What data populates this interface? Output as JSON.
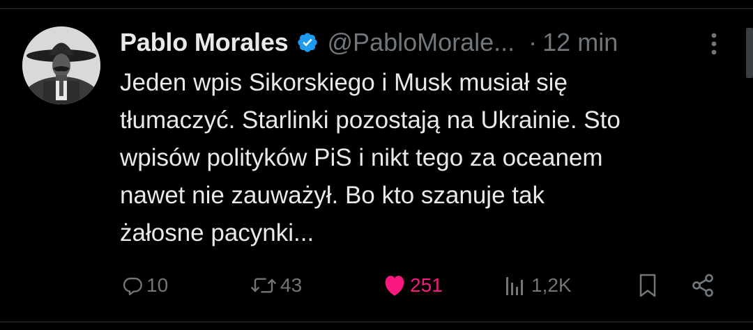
{
  "tweet": {
    "author": {
      "display_name": "Pablo Morales",
      "handle": "@PabloMorale...",
      "verified": true,
      "avatar": "sepia-portrait-man-sombrero"
    },
    "separator": "·",
    "time": "12 min",
    "text": "Jeden wpis Sikorskiego i Musk musiał się\ntłumaczyć. Starlinki pozostają na Ukrainie. Sto\nwpisów polityków PiS i nikt tego za oceanem\nnawet nie zauważył. Bo kto szanuje tak\nżałosne pacynki...",
    "actions": {
      "reply": {
        "icon": "reply-icon",
        "count": "10"
      },
      "retweet": {
        "icon": "retweet-icon",
        "count": "43"
      },
      "like": {
        "icon": "heart-icon",
        "count": "251",
        "liked": true
      },
      "views": {
        "icon": "views-icon",
        "count": "1,2K"
      },
      "bookmark": {
        "icon": "bookmark-icon"
      },
      "share": {
        "icon": "share-icon"
      }
    }
  },
  "colors": {
    "background": "#000000",
    "text": "#e7e9ea",
    "muted": "#71767b",
    "verified": "#1d9bf0",
    "like": "#f91880",
    "border": "#2f3336"
  }
}
